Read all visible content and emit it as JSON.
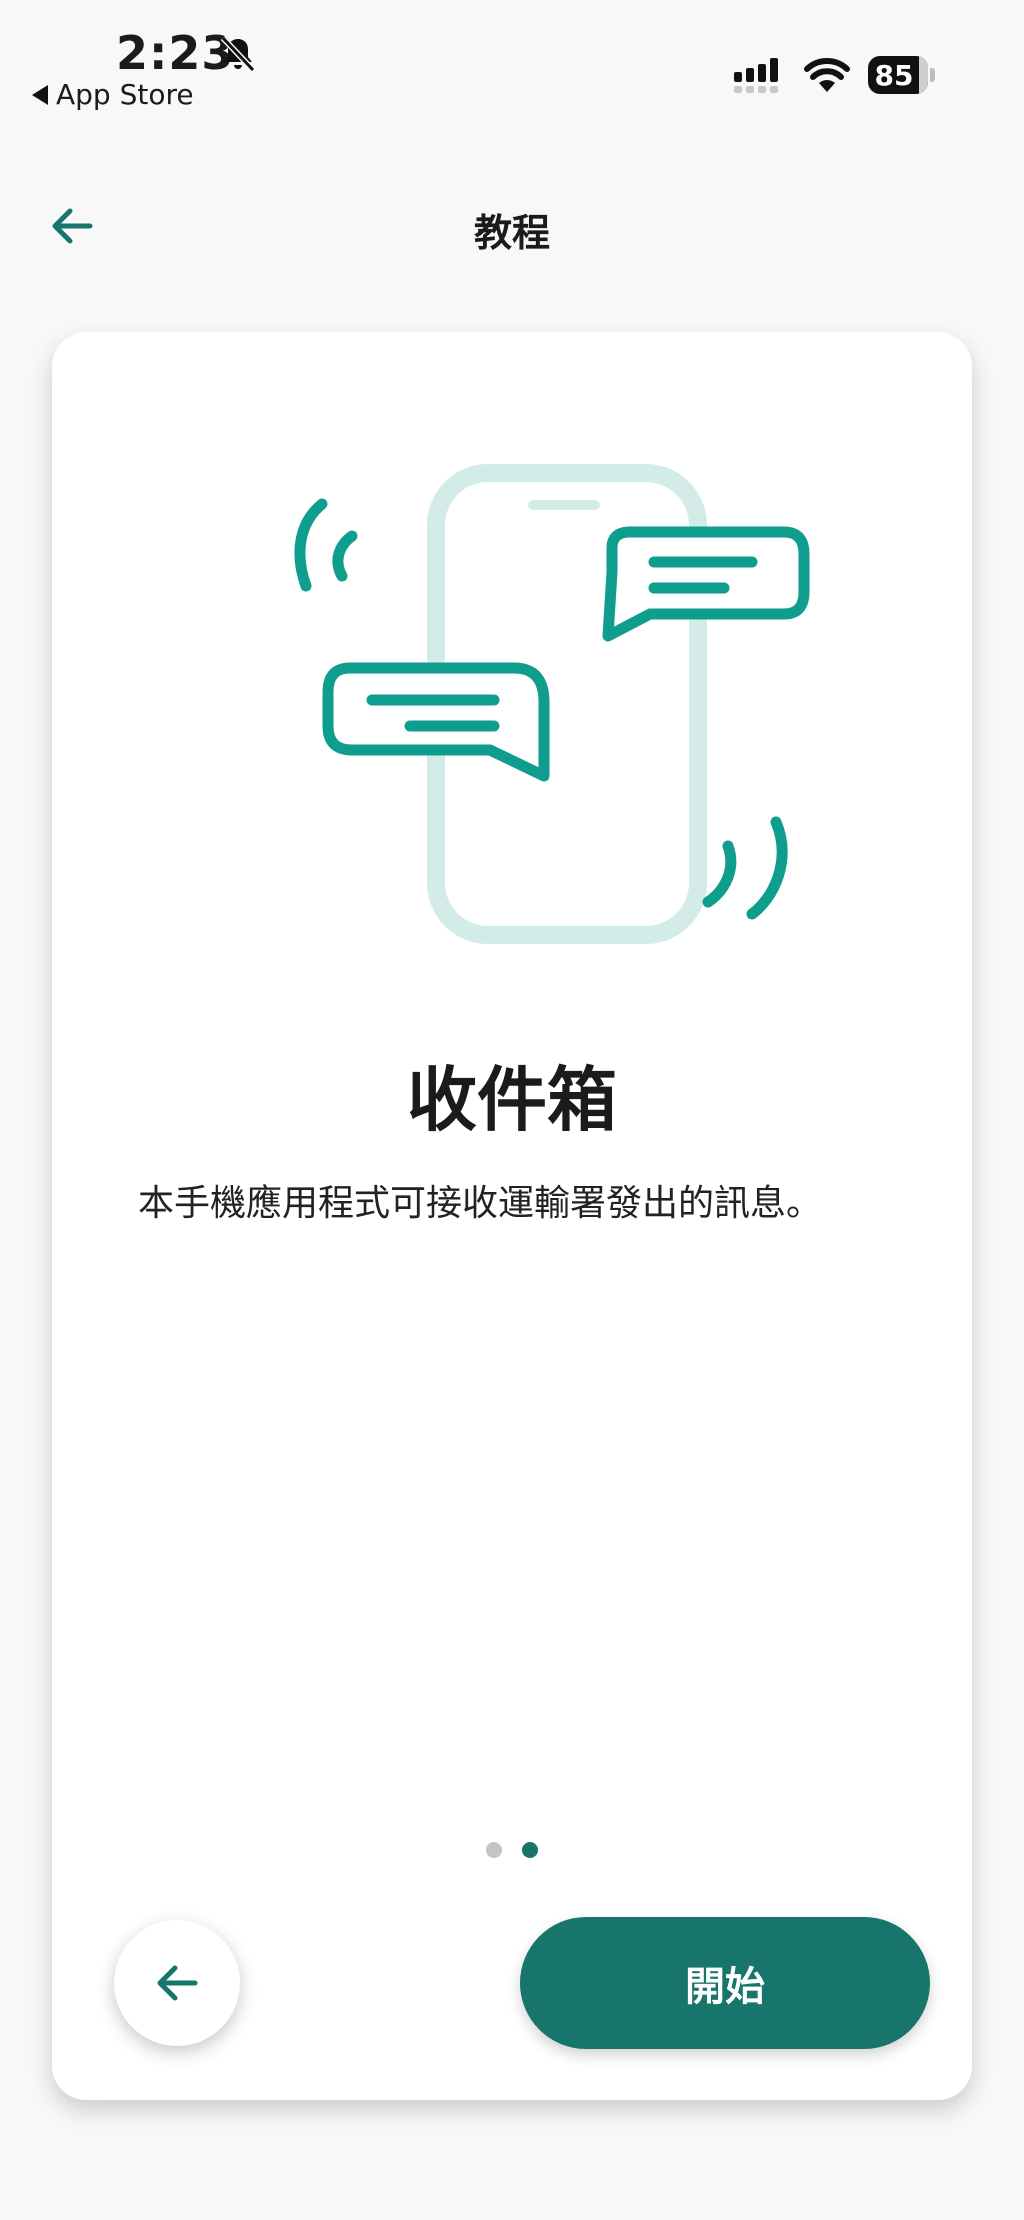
{
  "status_bar": {
    "time": "2:23",
    "back_app": "App Store",
    "battery_percent": "85"
  },
  "nav": {
    "title": "教程"
  },
  "card": {
    "title": "收件箱",
    "body": "本手機應用程式可接收運輸署發出的訊息。",
    "pagination": {
      "total": 2,
      "current": 2
    },
    "start_button": "開始"
  },
  "colors": {
    "accent": "#17756c",
    "illustration_green": "#0f9e8d",
    "illustration_light": "#d3ece8"
  }
}
